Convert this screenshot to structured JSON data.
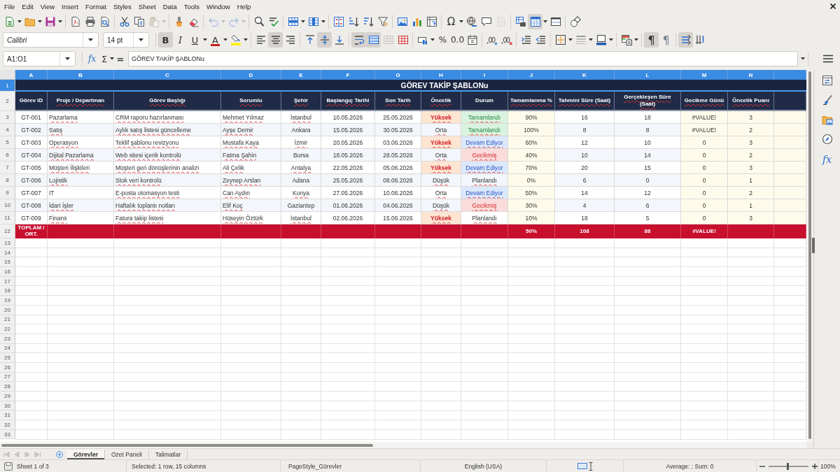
{
  "menu_bar": {
    "items": [
      "File",
      "Edit",
      "View",
      "Insert",
      "Format",
      "Styles",
      "Sheet",
      "Data",
      "Tools",
      "Window",
      "Help"
    ]
  },
  "standard_toolbar": {
    "special_character_label": "Ω",
    "disabled": {
      "paste": true,
      "undo": true,
      "redo": true,
      "header_footer": true
    },
    "pressed": {
      "freeze_rows_columns": true
    }
  },
  "formatting_toolbar": {
    "font_name": "Calibri",
    "font_size": "14 pt",
    "bold": {
      "label": "B",
      "pressed": true
    },
    "italic": {
      "label": "I",
      "pressed": false
    },
    "underline": {
      "label": "U",
      "pressed": false
    },
    "font_color": {
      "label": "A"
    },
    "align_left": {
      "pressed": false
    },
    "align_center": {
      "pressed": true
    },
    "align_right": {
      "pressed": false
    },
    "align_top": {
      "pressed": false
    },
    "align_middle": {
      "pressed": true
    },
    "align_bottom": {
      "pressed": false
    },
    "wrap_text": {
      "pressed": true
    },
    "merge_and_center": {
      "pressed": true
    },
    "merge_cells": {
      "disabled": true
    },
    "unmerge_cells": {
      "disabled": false
    },
    "percent": {
      "label": "%"
    },
    "number": {
      "label": "0.0"
    },
    "left_to_right": {
      "label": "¶",
      "pressed": true
    },
    "right_to_left": {
      "label": "¶",
      "pressed": false
    },
    "text_left_to_right": {
      "pressed": true
    },
    "text_top_to_bottom": {
      "pressed": false
    }
  },
  "formula_bar": {
    "name_box": "A1:O1",
    "function_wizard_label": "fx",
    "sum_label": "Σ",
    "formula_label": "=",
    "content": "GÖREV TAKİP ŞABLONu"
  },
  "sheet": {
    "column_headers": [
      {
        "letter": "A",
        "selected": true
      },
      {
        "letter": "B",
        "selected": true
      },
      {
        "letter": "C",
        "selected": true
      },
      {
        "letter": "D",
        "selected": true
      },
      {
        "letter": "E",
        "selected": true
      },
      {
        "letter": "F",
        "selected": true
      },
      {
        "letter": "G",
        "selected": true
      },
      {
        "letter": "H",
        "selected": true
      },
      {
        "letter": "I",
        "selected": true
      },
      {
        "letter": "J",
        "selected": true
      },
      {
        "letter": "K",
        "selected": true
      },
      {
        "letter": "L",
        "selected": true
      },
      {
        "letter": "M",
        "selected": true
      },
      {
        "letter": "N",
        "selected": true
      },
      {
        "selected": true
      }
    ],
    "row_numbers": [
      {
        "label": "1",
        "selected": true
      },
      {
        "label": "2",
        "selected": false
      },
      {
        "label": "3",
        "selected": false
      },
      {
        "label": "4",
        "selected": false
      },
      {
        "label": "5",
        "selected": false
      },
      {
        "label": "6",
        "selected": false
      },
      {
        "label": "7",
        "selected": false
      },
      {
        "label": "8",
        "selected": false
      },
      {
        "label": "9",
        "selected": false
      },
      {
        "label": "10",
        "selected": false
      },
      {
        "label": "11",
        "selected": false
      },
      {
        "label": "12",
        "selected": false
      },
      {
        "label": "13",
        "selected": false
      },
      {
        "label": "14",
        "selected": false
      },
      {
        "label": "15",
        "selected": false
      },
      {
        "label": "16",
        "selected": false
      },
      {
        "label": "17",
        "selected": false
      },
      {
        "label": "18",
        "selected": false
      },
      {
        "label": "19",
        "selected": false
      },
      {
        "label": "20",
        "selected": false
      },
      {
        "label": "21",
        "selected": false
      },
      {
        "label": "22",
        "selected": false
      },
      {
        "label": "23",
        "selected": false
      },
      {
        "label": "24",
        "selected": false
      },
      {
        "label": "25",
        "selected": false
      },
      {
        "label": "26",
        "selected": false
      },
      {
        "label": "27",
        "selected": false
      },
      {
        "label": "28",
        "selected": false
      },
      {
        "label": "29",
        "selected": false
      },
      {
        "label": "30",
        "selected": false
      },
      {
        "label": "31",
        "selected": false
      },
      {
        "label": "32",
        "selected": false
      },
      {
        "label": "33",
        "selected": false
      }
    ],
    "title": {
      "text": "GÖREV TAKİP ŞABLONu",
      "misspelled": true
    },
    "columns": [
      {
        "header": "Görev ID",
        "kind": "center",
        "misspelled": false
      },
      {
        "header": "Proje / Departman",
        "kind": "text",
        "misspelled": true
      },
      {
        "header": "Görev Başlığı",
        "kind": "text",
        "misspelled": true
      },
      {
        "header": "Sorumlu",
        "kind": "text",
        "misspelled": true
      },
      {
        "header": "Şehir",
        "kind": "center",
        "misspelled": true
      },
      {
        "header": "Başlangıç Tarihi",
        "kind": "center",
        "misspelled": true
      },
      {
        "header": "Son Tarih",
        "kind": "center",
        "misspelled": true
      },
      {
        "header": "Öncelik",
        "kind": "center",
        "misspelled": true
      },
      {
        "header": "Durum",
        "kind": "center",
        "misspelled": false
      },
      {
        "header": "Tamamlanma %",
        "kind": "metric",
        "misspelled": true
      },
      {
        "header": "Tahmini Süre (Saat)",
        "kind": "center",
        "misspelled": true
      },
      {
        "header": "Gerçekleşen Süre (Saat)",
        "kind": "center",
        "misspelled": true
      },
      {
        "header": "Gecikme Günü",
        "kind": "metric",
        "misspelled": true
      },
      {
        "header": "Öncelik Puanı",
        "kind": "metric",
        "misspelled": true
      },
      {
        "kind": "metric"
      }
    ],
    "rows": [
      {
        "cells": [
          "GT-001",
          "Pazarlama",
          "CRM raporu hazırlanması",
          "Mehmet Yılmaz",
          "İstanbul",
          "10.05.2026",
          "25.05.2026",
          {
            "text": "Yüksek",
            "kind": "high"
          },
          {
            "text": "Tamamlandı",
            "kind": "done"
          },
          "90%",
          "16",
          "18",
          "#VALUE!",
          "3"
        ],
        "misspelled": [
          false,
          true,
          true,
          true,
          true,
          false,
          false,
          true,
          true,
          false,
          false,
          false,
          false,
          false
        ]
      },
      {
        "cells": [
          "GT-002",
          "Satış",
          "Aylık satış listesi güncelleme",
          "Ayşe Demir",
          "Ankara",
          "15.05.2026",
          "30.05.2026",
          {
            "text": "Orta",
            "kind": "medium"
          },
          {
            "text": "Tamamlandı",
            "kind": "done"
          },
          "100%",
          "8",
          "8",
          "#VALUE!",
          "2"
        ],
        "misspelled": [
          false,
          true,
          true,
          true,
          false,
          false,
          false,
          true,
          true,
          false,
          false,
          false,
          false,
          false
        ]
      },
      {
        "cells": [
          "GT-003",
          "Operasyon",
          "Teklif şablonu revizyonu",
          "Mustafa Kaya",
          "İzmir",
          "20.05.2026",
          "03.06.2026",
          {
            "text": "Yüksek",
            "kind": "high"
          },
          {
            "text": "Devam Ediyor",
            "kind": "ongoing"
          },
          "60%",
          "12",
          "10",
          "0",
          "3"
        ],
        "misspelled": [
          false,
          true,
          true,
          true,
          true,
          false,
          false,
          true,
          true,
          false,
          false,
          false,
          false,
          false
        ]
      },
      {
        "cells": [
          "GT-004",
          "Dijital Pazarlama",
          "Web sitesi içerik kontrolü",
          "Fatma Şahin",
          "Bursa",
          "18.05.2026",
          "28.05.2026",
          {
            "text": "Orta",
            "kind": "medium"
          },
          {
            "text": "Gecikmiş",
            "kind": "late"
          },
          "40%",
          "10",
          "14",
          "0",
          "2"
        ],
        "misspelled": [
          false,
          true,
          true,
          true,
          false,
          false,
          false,
          true,
          true,
          false,
          false,
          false,
          false,
          false
        ]
      },
      {
        "cells": [
          "GT-005",
          "Müşteri İlişkileri",
          "Müşteri geri dönüşlerinin analizi",
          "Ali Çelik",
          "Antalya",
          "22.05.2026",
          "05.06.2026",
          {
            "text": "Yüksek",
            "kind": "high"
          },
          {
            "text": "Devam Ediyor",
            "kind": "ongoing"
          },
          "70%",
          "20",
          "15",
          "0",
          "3"
        ],
        "misspelled": [
          false,
          true,
          true,
          true,
          true,
          false,
          false,
          true,
          true,
          false,
          false,
          false,
          false,
          false
        ]
      },
      {
        "cells": [
          "GT-006",
          "Lojistik",
          "Stok veri kontrolü",
          "Zeynep Arslan",
          "Adana",
          "25.05.2026",
          "08.06.2026",
          {
            "text": "Düşük",
            "kind": "low"
          },
          {
            "text": "Planlandı",
            "kind": "planned"
          },
          "0%",
          "6",
          "0",
          "0",
          "1"
        ],
        "misspelled": [
          false,
          true,
          true,
          true,
          false,
          false,
          false,
          true,
          true,
          false,
          false,
          false,
          false,
          false
        ]
      },
      {
        "cells": [
          "GT-007",
          "IT",
          "E-posta otomasyon testi",
          "Can Aydın",
          "Konya",
          "27.05.2026",
          "10.06.2026",
          {
            "text": "Orta",
            "kind": "medium"
          },
          {
            "text": "Devam Ediyor",
            "kind": "ongoing"
          },
          "50%",
          "14",
          "12",
          "0",
          "2"
        ],
        "misspelled": [
          false,
          false,
          true,
          true,
          true,
          false,
          false,
          true,
          true,
          false,
          false,
          false,
          false,
          false
        ]
      },
      {
        "cells": [
          "GT-008",
          "İdari İşler",
          "Haftalık toplantı notları",
          "Elif Koç",
          "Gaziantep",
          "01.06.2026",
          "04.06.2026",
          {
            "text": "Düşük",
            "kind": "low"
          },
          {
            "text": "Gecikmiş",
            "kind": "late"
          },
          "30%",
          "4",
          "6",
          "0",
          "1"
        ],
        "misspelled": [
          false,
          true,
          true,
          true,
          false,
          false,
          false,
          true,
          true,
          false,
          false,
          false,
          false,
          false
        ]
      },
      {
        "cells": [
          "GT-009",
          "Finans",
          "Fatura takip listesi",
          "Hüseyin Öztürk",
          "İstanbul",
          "02.06.2026",
          "15.06.2026",
          {
            "text": "Yüksek",
            "kind": "high"
          },
          {
            "text": "Planlandı",
            "kind": "planned"
          },
          "10%",
          "18",
          "5",
          "0",
          "3"
        ],
        "misspelled": [
          false,
          true,
          true,
          true,
          true,
          false,
          false,
          true,
          true,
          false,
          false,
          false,
          false,
          false
        ]
      }
    ],
    "totals": {
      "cells": [
        "TOPLAM / ORT.",
        null,
        null,
        null,
        null,
        null,
        null,
        null,
        null,
        "50%",
        "108",
        "88",
        "#VALUE!",
        null,
        null
      ]
    }
  },
  "sidebar": {
    "functions_label": "fx"
  },
  "sheet_tabs": [
    {
      "label": "Görevler",
      "selected": true
    },
    {
      "label": "Ozet Paneli",
      "selected": false
    },
    {
      "label": "Talimatlar",
      "selected": false
    }
  ],
  "status_bar": {
    "sheet": "Sheet 1 of 3",
    "selection": "Selected: 1 row, 15 columns",
    "page_style": "PageStyle_Görevler",
    "language": "English (USA)",
    "summary": "Average: ; Sum: 0",
    "zoom": {
      "level": 0.47
    },
    "zoom_label": "100%"
  }
}
